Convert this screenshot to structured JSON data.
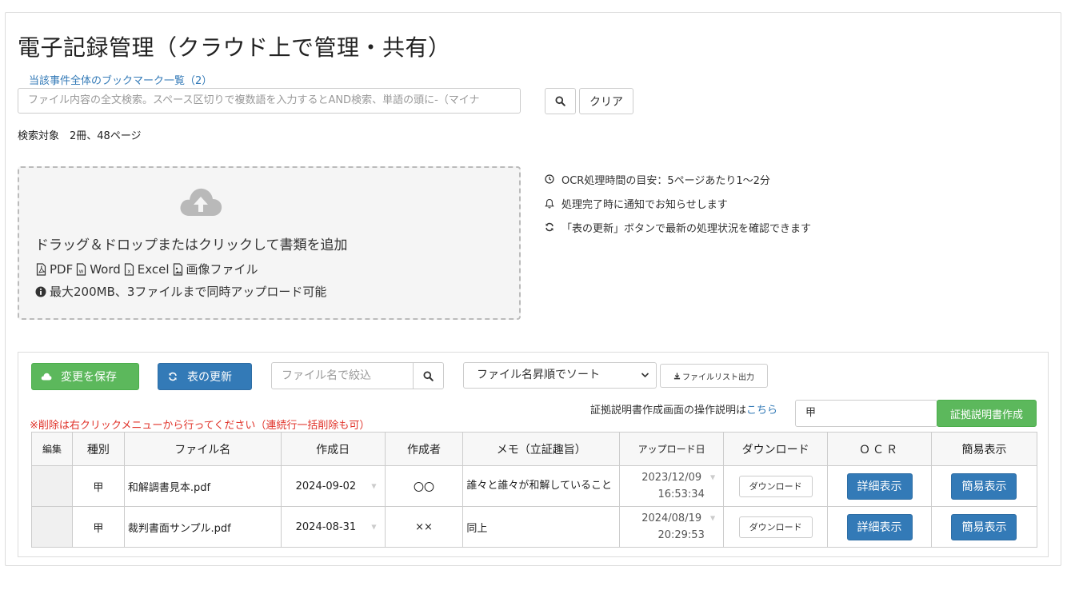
{
  "page": {
    "title": "電子記録管理（クラウド上で管理・共有）",
    "bookmark_link": "当該事件全体のブックマーク一覧（2）",
    "search_placeholder": "ファイル内容の全文検索。スペース区切りで複数語を入力するとAND検索、単語の頭に-（マイナ",
    "clear_label": "クリア",
    "search_target": "検索対象　2冊、48ページ"
  },
  "dropzone": {
    "title": "ドラッグ＆ドロップまたはクリックして書類を追加",
    "types": [
      "PDF",
      "Word",
      "Excel",
      "画像ファイル"
    ],
    "limit": "最大200MB、3ファイルまで同時アップロード可能"
  },
  "info": [
    {
      "icon": "clock-icon",
      "text": "OCR処理時間の目安：5ページあたり1〜2分"
    },
    {
      "icon": "bell-icon",
      "text": "処理完了時に通知でお知らせします"
    },
    {
      "icon": "refresh-icon",
      "text": "「表の更新」ボタンで最新の処理状況を確認できます"
    }
  ],
  "toolbar": {
    "save_label": "変更を保存",
    "refresh_label": "表の更新",
    "filter_placeholder": "ファイル名で絞込",
    "sort_selected": "ファイル名昇順でソート",
    "export_label": "ファイルリスト出力",
    "guide_prefix": "証拠説明書作成画面の操作説明は",
    "guide_link": "こちら",
    "mark_value": "甲",
    "evidence_label": "証拠説明書作成",
    "delete_note": "※削除は右クリックメニューから行ってください（連続行一括削除も可）"
  },
  "table": {
    "headers": [
      "編集",
      "種別",
      "ファイル名",
      "作成日",
      "作成者",
      "メモ（立証趣旨）",
      "アップロード日",
      "ダウンロード",
      "ＯＣＲ",
      "簡易表示"
    ],
    "rows": [
      {
        "type": "甲",
        "filename": "和解調書見本.pdf",
        "created": "2024-09-02",
        "author": "〇〇",
        "memo": "誰々と誰々が和解していること",
        "upload_date": "2023/12/09",
        "upload_time": "16:53:34",
        "download": "ダウンロード",
        "ocr": "詳細表示",
        "simple": "簡易表示"
      },
      {
        "type": "甲",
        "filename": "裁判書面サンプル.pdf",
        "created": "2024-08-31",
        "author": "××",
        "memo": "同上",
        "upload_date": "2024/08/19",
        "upload_time": "20:29:53",
        "download": "ダウンロード",
        "ocr": "詳細表示",
        "simple": "簡易表示"
      }
    ]
  },
  "colors": {
    "primary": "#337ab7",
    "success": "#5cb85c",
    "danger": "#e0332a"
  }
}
